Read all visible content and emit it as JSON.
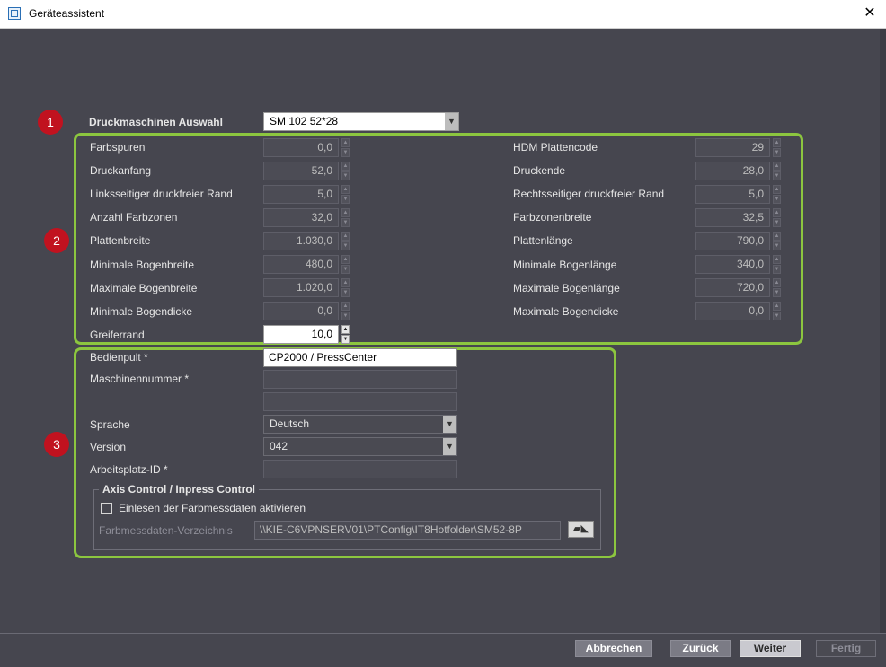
{
  "window": {
    "title": "Geräteassistent",
    "close_glyph": "✕"
  },
  "markers": [
    "1",
    "2",
    "3"
  ],
  "selection": {
    "label": "Druckmaschinen Auswahl",
    "value": "SM 102 52*28"
  },
  "left_fields": [
    {
      "label": "Farbspuren",
      "value": "0,0"
    },
    {
      "label": "Druckanfang",
      "value": "52,0"
    },
    {
      "label": "Linksseitiger druckfreier Rand",
      "value": "5,0"
    },
    {
      "label": "Anzahl Farbzonen",
      "value": "32,0"
    },
    {
      "label": "Plattenbreite",
      "value": "1.030,0"
    },
    {
      "label": "Minimale Bogenbreite",
      "value": "480,0"
    },
    {
      "label": "Maximale Bogenbreite",
      "value": "1.020,0"
    },
    {
      "label": "Minimale Bogendicke",
      "value": "0,0"
    },
    {
      "label": "Greiferrand",
      "value": "10,0"
    }
  ],
  "right_fields": [
    {
      "label": "HDM Plattencode",
      "value": "29"
    },
    {
      "label": "Druckende",
      "value": "28,0"
    },
    {
      "label": "Rechtsseitiger druckfreier Rand",
      "value": "5,0"
    },
    {
      "label": "Farbzonenbreite",
      "value": "32,5"
    },
    {
      "label": "Plattenlänge",
      "value": "790,0"
    },
    {
      "label": "Minimale Bogenlänge",
      "value": "340,0"
    },
    {
      "label": "Maximale Bogenlänge",
      "value": "720,0"
    },
    {
      "label": "Maximale Bogendicke",
      "value": "0,0"
    }
  ],
  "config": {
    "bedienpult_label": "Bedienpult *",
    "bedienpult_value": "CP2000 / PressCenter",
    "maschinennummer_label": "Maschinennummer *",
    "maschinennummer_value": "",
    "maschinennummer_value2": "",
    "sprache_label": "Sprache",
    "sprache_value": "Deutsch",
    "version_label": "Version",
    "version_value": "042",
    "arbeitsplatz_label": "Arbeitsplatz-ID *",
    "arbeitsplatz_value": ""
  },
  "axis_control": {
    "title": "Axis Control / Inpress Control",
    "checkbox_label": "Einlesen der Farbmessdaten aktivieren",
    "checked": false,
    "dir_label": "Farbmessdaten-Verzeichnis",
    "dir_value": "\\\\KIE-C6VPNSERV01\\PTConfig\\IT8Hotfolder\\SM52-8P"
  },
  "buttons": {
    "cancel": "Abbrechen",
    "back": "Zurück",
    "next": "Weiter",
    "finish": "Fertig"
  },
  "colors": {
    "background": "#46464f",
    "highlight": "#8cc63f",
    "marker": "#c1121f"
  },
  "icons": {
    "app": "wizard-app-icon",
    "browse": "folder-browse-icon",
    "dropdown": "chevron-down-icon"
  }
}
